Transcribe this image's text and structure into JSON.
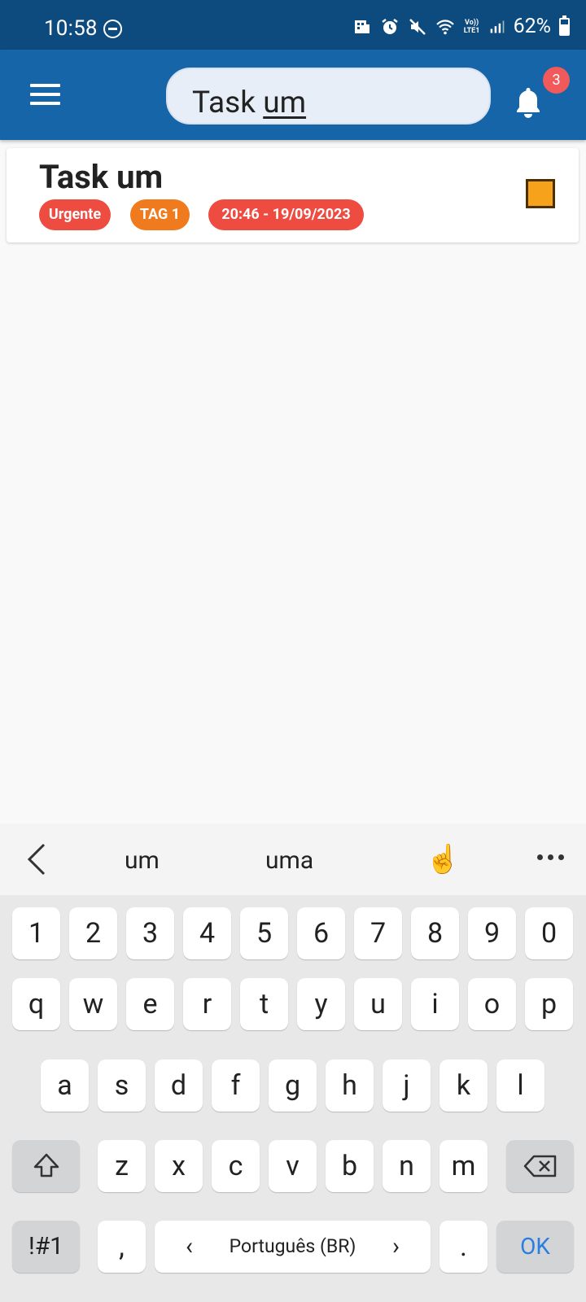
{
  "status_bar": {
    "time": "10:58",
    "battery": "62%",
    "icons": [
      "do-not-disturb-icon",
      "app-notification-icon",
      "alarm-icon",
      "mute-icon",
      "wifi-icon",
      "volte-icon",
      "signal-icon",
      "battery-icon"
    ],
    "volte_label": "Vo)) LTE1"
  },
  "app_bar": {
    "search_value": "Task um",
    "search_prefix": "Task ",
    "search_composing": "um",
    "notification_count": "3",
    "colors": {
      "primary": "#1565a8",
      "status": "#0d4a7e"
    }
  },
  "tasks": [
    {
      "title": "Task um",
      "priority": "Urgente",
      "tag": "TAG 1",
      "datetime": "20:46 - 19/09/2023",
      "checkbox_color": "#f7a21b"
    }
  ],
  "keyboard": {
    "suggestions": [
      "um",
      "uma",
      "☝️"
    ],
    "rows": {
      "numbers": [
        "1",
        "2",
        "3",
        "4",
        "5",
        "6",
        "7",
        "8",
        "9",
        "0"
      ],
      "row1": [
        "q",
        "w",
        "e",
        "r",
        "t",
        "y",
        "u",
        "i",
        "o",
        "p"
      ],
      "row2": [
        "a",
        "s",
        "d",
        "f",
        "g",
        "h",
        "j",
        "k",
        "l"
      ],
      "row3": [
        "z",
        "x",
        "c",
        "v",
        "b",
        "n",
        "m"
      ]
    },
    "symbols_label": "!#1",
    "comma": ",",
    "space_label": "Português (BR)",
    "period": ".",
    "ok_label": "OK"
  }
}
